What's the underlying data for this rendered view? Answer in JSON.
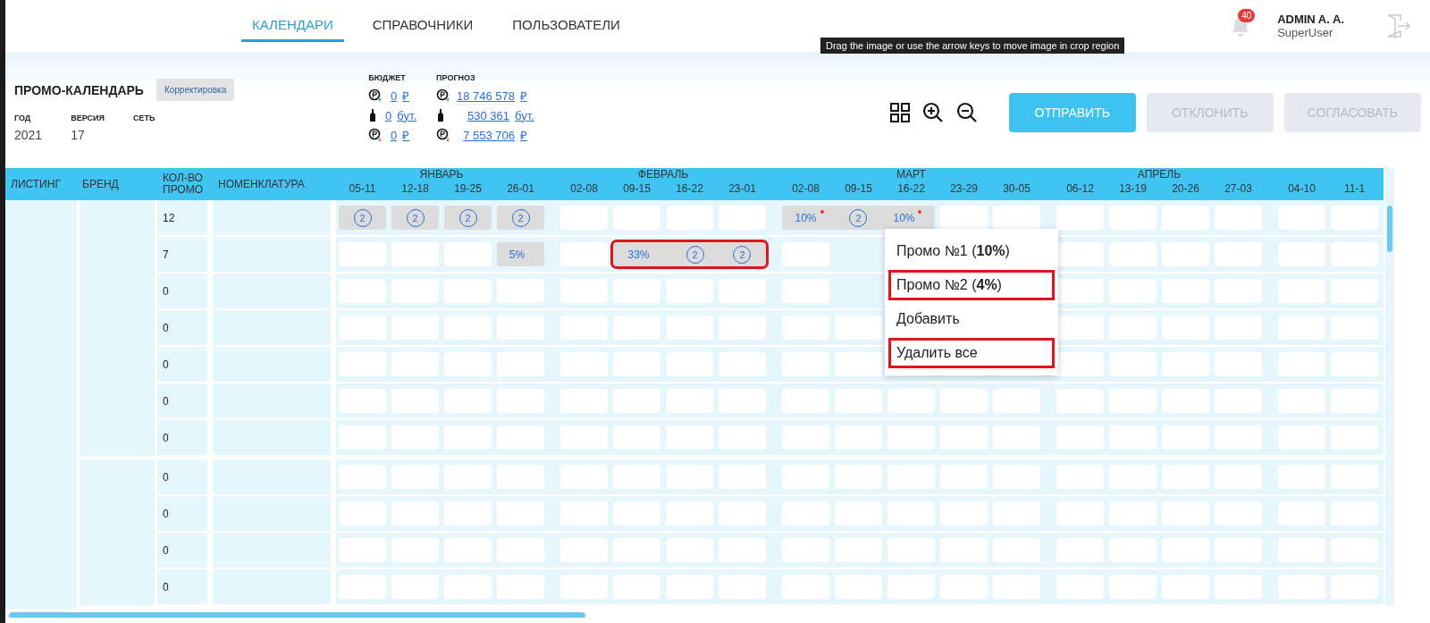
{
  "nav": {
    "tabs": [
      {
        "label": "КАЛЕНДАРИ",
        "selected": true
      },
      {
        "label": "СПРАВОЧНИКИ",
        "selected": false
      },
      {
        "label": "ПОЛЬЗОВАТЕЛИ",
        "selected": false
      }
    ]
  },
  "user": {
    "notifications": "40",
    "name": "ADMIN A. A.",
    "role": "SuperUser"
  },
  "tooltip": "Drag the image or use the arrow keys to move image in crop region",
  "calendar": {
    "title": "ПРОМО-КАЛЕНДАРЬ",
    "status": "Корректировка",
    "fields": [
      {
        "label": "ГОД",
        "value": "2021"
      },
      {
        "label": "ВЕРСИЯ",
        "value": "17"
      },
      {
        "label": "СЕТЬ"
      }
    ],
    "totals": [
      {
        "title": "БЮДЖЕТ",
        "lines": [
          {
            "kind": "income",
            "value": "0",
            "unit": "₽"
          },
          {
            "kind": "bottle",
            "value": "0",
            "unit": "бут."
          },
          {
            "kind": "expense",
            "value": "0",
            "unit": "₽"
          }
        ]
      },
      {
        "title": "ПРОГНОЗ",
        "lines": [
          {
            "kind": "income",
            "value": "18 746 578",
            "unit": "₽"
          },
          {
            "kind": "bottle",
            "value": "530 361",
            "unit": "бут."
          },
          {
            "kind": "expense",
            "value": "7 553 706",
            "unit": "₽"
          }
        ]
      }
    ],
    "buttons": [
      {
        "label": "ОТПРАВИТЬ",
        "disabled": false
      },
      {
        "label": "ОТКЛОНИТЬ",
        "disabled": true
      },
      {
        "label": "СОГЛАСОВАТЬ",
        "disabled": true
      }
    ]
  },
  "table": {
    "columns": [
      "ЛИСТИНГ",
      "БРЕНД",
      "КОЛ-ВО ПРОМО",
      "НОМЕНКЛАТУРА"
    ],
    "months": [
      {
        "label": "ЯНВАРЬ",
        "weeks": [
          "05-11",
          "12-18",
          "19-25",
          "26-01"
        ]
      },
      {
        "label": "ФЕВРАЛЬ",
        "weeks": [
          "02-08",
          "09-15",
          "16-22",
          "23-01"
        ]
      },
      {
        "label": "МАРТ",
        "weeks": [
          "02-08",
          "09-15",
          "16-22",
          "23-29",
          "30-05"
        ]
      },
      {
        "label": "АПРЕЛЬ",
        "weeks": [
          "06-12",
          "13-19",
          "20-26",
          "27-03"
        ]
      },
      {
        "weeks": [
          "04-10",
          "11-1"
        ]
      }
    ],
    "brands": [
      {
        "rows": [
          {
            "count": "12",
            "cells": [
              {
                "kind": "promo",
                "outlined": false,
                "parts": [
                  {
                    "kind": "circle",
                    "text": "2"
                  }
                ]
              },
              {
                "kind": "promo",
                "outlined": false,
                "parts": [
                  {
                    "kind": "circle",
                    "text": "2"
                  }
                ]
              },
              {
                "kind": "promo",
                "outlined": false,
                "parts": [
                  {
                    "kind": "circle",
                    "text": "2"
                  }
                ]
              },
              {
                "kind": "promo",
                "outlined": false,
                "parts": [
                  {
                    "kind": "circle",
                    "text": "2"
                  }
                ]
              },
              {
                "kind": "empty"
              },
              {
                "kind": "empty"
              },
              {
                "kind": "empty"
              },
              {
                "kind": "empty"
              },
              {
                "kind": "promo",
                "outlined": false,
                "parts": [
                  {
                    "kind": "percent",
                    "text": "10%",
                    "flagged": true
                  },
                  {
                    "kind": "circle",
                    "text": "2"
                  },
                  {
                    "kind": "percent",
                    "text": "10%",
                    "flagged": true
                  }
                ]
              }
            ]
          },
          {
            "count": "7",
            "cells": [
              {
                "kind": "empty"
              },
              {
                "kind": "empty"
              },
              {
                "kind": "empty"
              },
              {
                "kind": "promo",
                "outlined": false,
                "parts": [
                  {
                    "kind": "percent",
                    "text": "5%",
                    "flagged": false
                  }
                ]
              },
              {
                "kind": "empty"
              },
              {
                "kind": "promo",
                "outlined": true,
                "parts": [
                  {
                    "kind": "percent",
                    "text": "33%",
                    "flagged": false
                  },
                  {
                    "kind": "circle",
                    "text": "2"
                  },
                  {
                    "kind": "circle",
                    "text": "2"
                  }
                ]
              },
              {
                "kind": "empty"
              },
              {
                "kind": "hidden"
              },
              {
                "kind": "hidden"
              },
              {
                "kind": "hidden"
              }
            ]
          },
          {
            "count": "0",
            "cells": [
              {
                "kind": "empty"
              },
              {
                "kind": "empty"
              },
              {
                "kind": "empty"
              },
              {
                "kind": "empty"
              },
              {
                "kind": "empty"
              },
              {
                "kind": "empty"
              },
              {
                "kind": "empty"
              },
              {
                "kind": "empty"
              },
              {
                "kind": "empty"
              },
              {
                "kind": "hidden"
              }
            ]
          },
          {
            "count": "0"
          },
          {
            "count": "0"
          },
          {
            "count": "0"
          },
          {
            "count": "0"
          }
        ]
      },
      {
        "rows": [
          {
            "count": "0"
          },
          {
            "count": "0"
          },
          {
            "count": "0"
          },
          {
            "count": "0"
          }
        ]
      }
    ]
  },
  "menu": {
    "items": [
      {
        "label": "Промо №1 (**10%**)",
        "outlined": false
      },
      {
        "label": "Промо №2  (**4%**)",
        "outlined": true
      },
      {
        "label": "Добавить",
        "outlined": false
      },
      {
        "label": "Удалить все",
        "outlined": true
      }
    ]
  }
}
